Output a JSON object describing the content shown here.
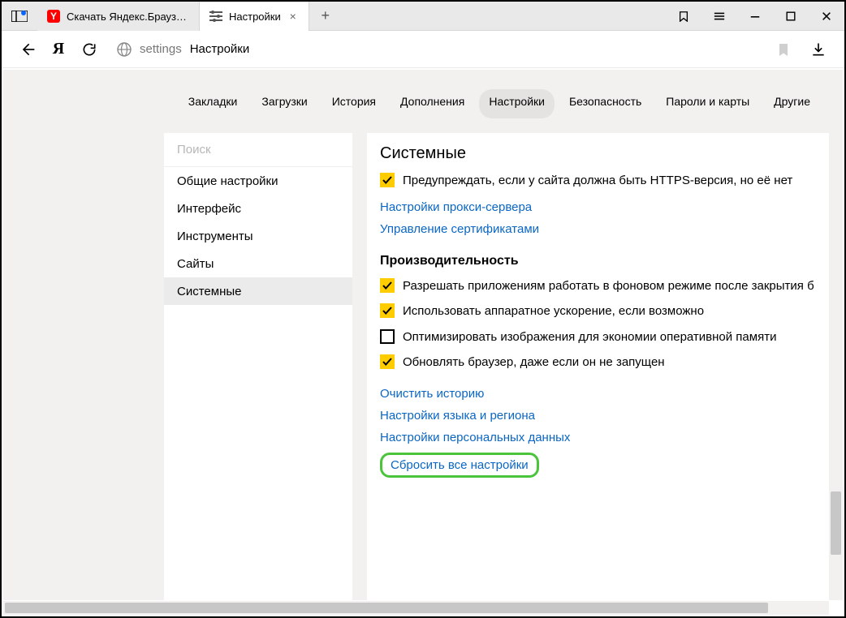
{
  "titlebar": {
    "tabs": [
      {
        "title": "Скачать Яндекс.Браузер д",
        "active": false
      },
      {
        "title": "Настройки",
        "active": true
      }
    ]
  },
  "addr": {
    "host": "settings",
    "title": "Настройки"
  },
  "nav": {
    "items": [
      "Закладки",
      "Загрузки",
      "История",
      "Дополнения",
      "Настройки",
      "Безопасность",
      "Пароли и карты",
      "Другие"
    ],
    "active_index": 4
  },
  "sidebar": {
    "search_placeholder": "Поиск",
    "items": [
      "Общие настройки",
      "Интерфейс",
      "Инструменты",
      "Сайты",
      "Системные"
    ],
    "active_index": 4
  },
  "main": {
    "title": "Системные",
    "network": {
      "https_warn": {
        "checked": true,
        "label": "Предупреждать, если у сайта должна быть HTTPS-версия, но её нет"
      },
      "proxy_link": "Настройки прокси-сервера",
      "cert_link": "Управление сертификатами"
    },
    "performance": {
      "title": "Производительность",
      "bg_apps": {
        "checked": true,
        "label": "Разрешать приложениям работать в фоновом режиме после закрытия б"
      },
      "hw_accel": {
        "checked": true,
        "label": "Использовать аппаратное ускорение, если возможно"
      },
      "opt_img": {
        "checked": false,
        "label": "Оптимизировать изображения для экономии оперативной памяти"
      },
      "auto_upd": {
        "checked": true,
        "label": "Обновлять браузер, даже если он не запущен"
      }
    },
    "links": {
      "clear_history": "Очистить историю",
      "lang_region": "Настройки языка и региона",
      "personal_data": "Настройки персональных данных",
      "reset_all": "Сбросить все настройки"
    }
  }
}
